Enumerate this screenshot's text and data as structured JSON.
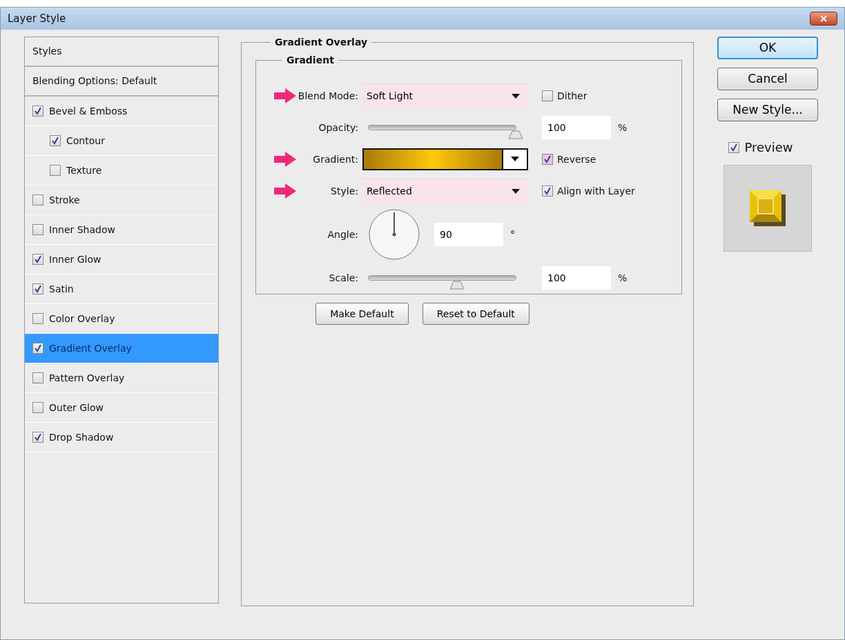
{
  "window": {
    "title": "Layer Style",
    "close": "×"
  },
  "styles_list": {
    "items": [
      {
        "kind": "header",
        "label": "Styles",
        "selected": false
      },
      {
        "kind": "header",
        "label": "Blending Options: Default",
        "selected": false
      },
      {
        "kind": "check",
        "label": "Bevel & Emboss",
        "checked": true,
        "selected": false,
        "children": [
          {
            "kind": "check",
            "label": "Contour",
            "checked": true,
            "selected": false
          },
          {
            "kind": "check",
            "label": "Texture",
            "checked": false,
            "selected": false
          }
        ]
      },
      {
        "kind": "check",
        "label": "Stroke",
        "checked": false,
        "selected": false
      },
      {
        "kind": "check",
        "label": "Inner Shadow",
        "checked": false,
        "selected": false
      },
      {
        "kind": "check",
        "label": "Inner Glow",
        "checked": true,
        "selected": false
      },
      {
        "kind": "check",
        "label": "Satin",
        "checked": true,
        "selected": false
      },
      {
        "kind": "check",
        "label": "Color Overlay",
        "checked": false,
        "selected": false
      },
      {
        "kind": "check",
        "label": "Gradient Overlay",
        "checked": true,
        "selected": true
      },
      {
        "kind": "check",
        "label": "Pattern Overlay",
        "checked": false,
        "selected": false
      },
      {
        "kind": "check",
        "label": "Outer Glow",
        "checked": false,
        "selected": false
      },
      {
        "kind": "check",
        "label": "Drop Shadow",
        "checked": true,
        "selected": false
      }
    ]
  },
  "panel": {
    "title": "Gradient Overlay",
    "group": {
      "title": "Gradient",
      "rows": [
        {
          "kind": "dropdown",
          "label": "Blend Mode:",
          "value": "Soft Light",
          "marked": true,
          "option": {
            "label": "Dither",
            "checked": false,
            "highlighted": false
          }
        },
        {
          "kind": "slider",
          "label": "Opacity:",
          "level": 1,
          "value": "100",
          "unit": "%",
          "marked": false
        },
        {
          "kind": "gradient",
          "label": "Gradient:",
          "marked": true,
          "option": {
            "label": "Reverse",
            "checked": true,
            "highlighted": true
          }
        },
        {
          "kind": "dropdown",
          "label": "Style:",
          "value": "Reflected",
          "marked": true,
          "option": {
            "label": "Align with Layer",
            "checked": true,
            "highlighted": false
          }
        },
        {
          "kind": "angle",
          "label": "Angle:",
          "value": "90",
          "unit": "°",
          "marked": false
        },
        {
          "kind": "slider",
          "label": "Scale:",
          "level": 0.6,
          "value": "100",
          "unit": "%",
          "marked": false
        }
      ]
    },
    "buttons": [
      "Make Default",
      "Reset to Default"
    ]
  },
  "actions": {
    "buttons": [
      {
        "label": "OK",
        "default": true
      },
      {
        "label": "Cancel",
        "default": false
      },
      {
        "label": "New Style...",
        "default": false
      }
    ],
    "preview": {
      "label": "Preview",
      "checked": true
    }
  }
}
